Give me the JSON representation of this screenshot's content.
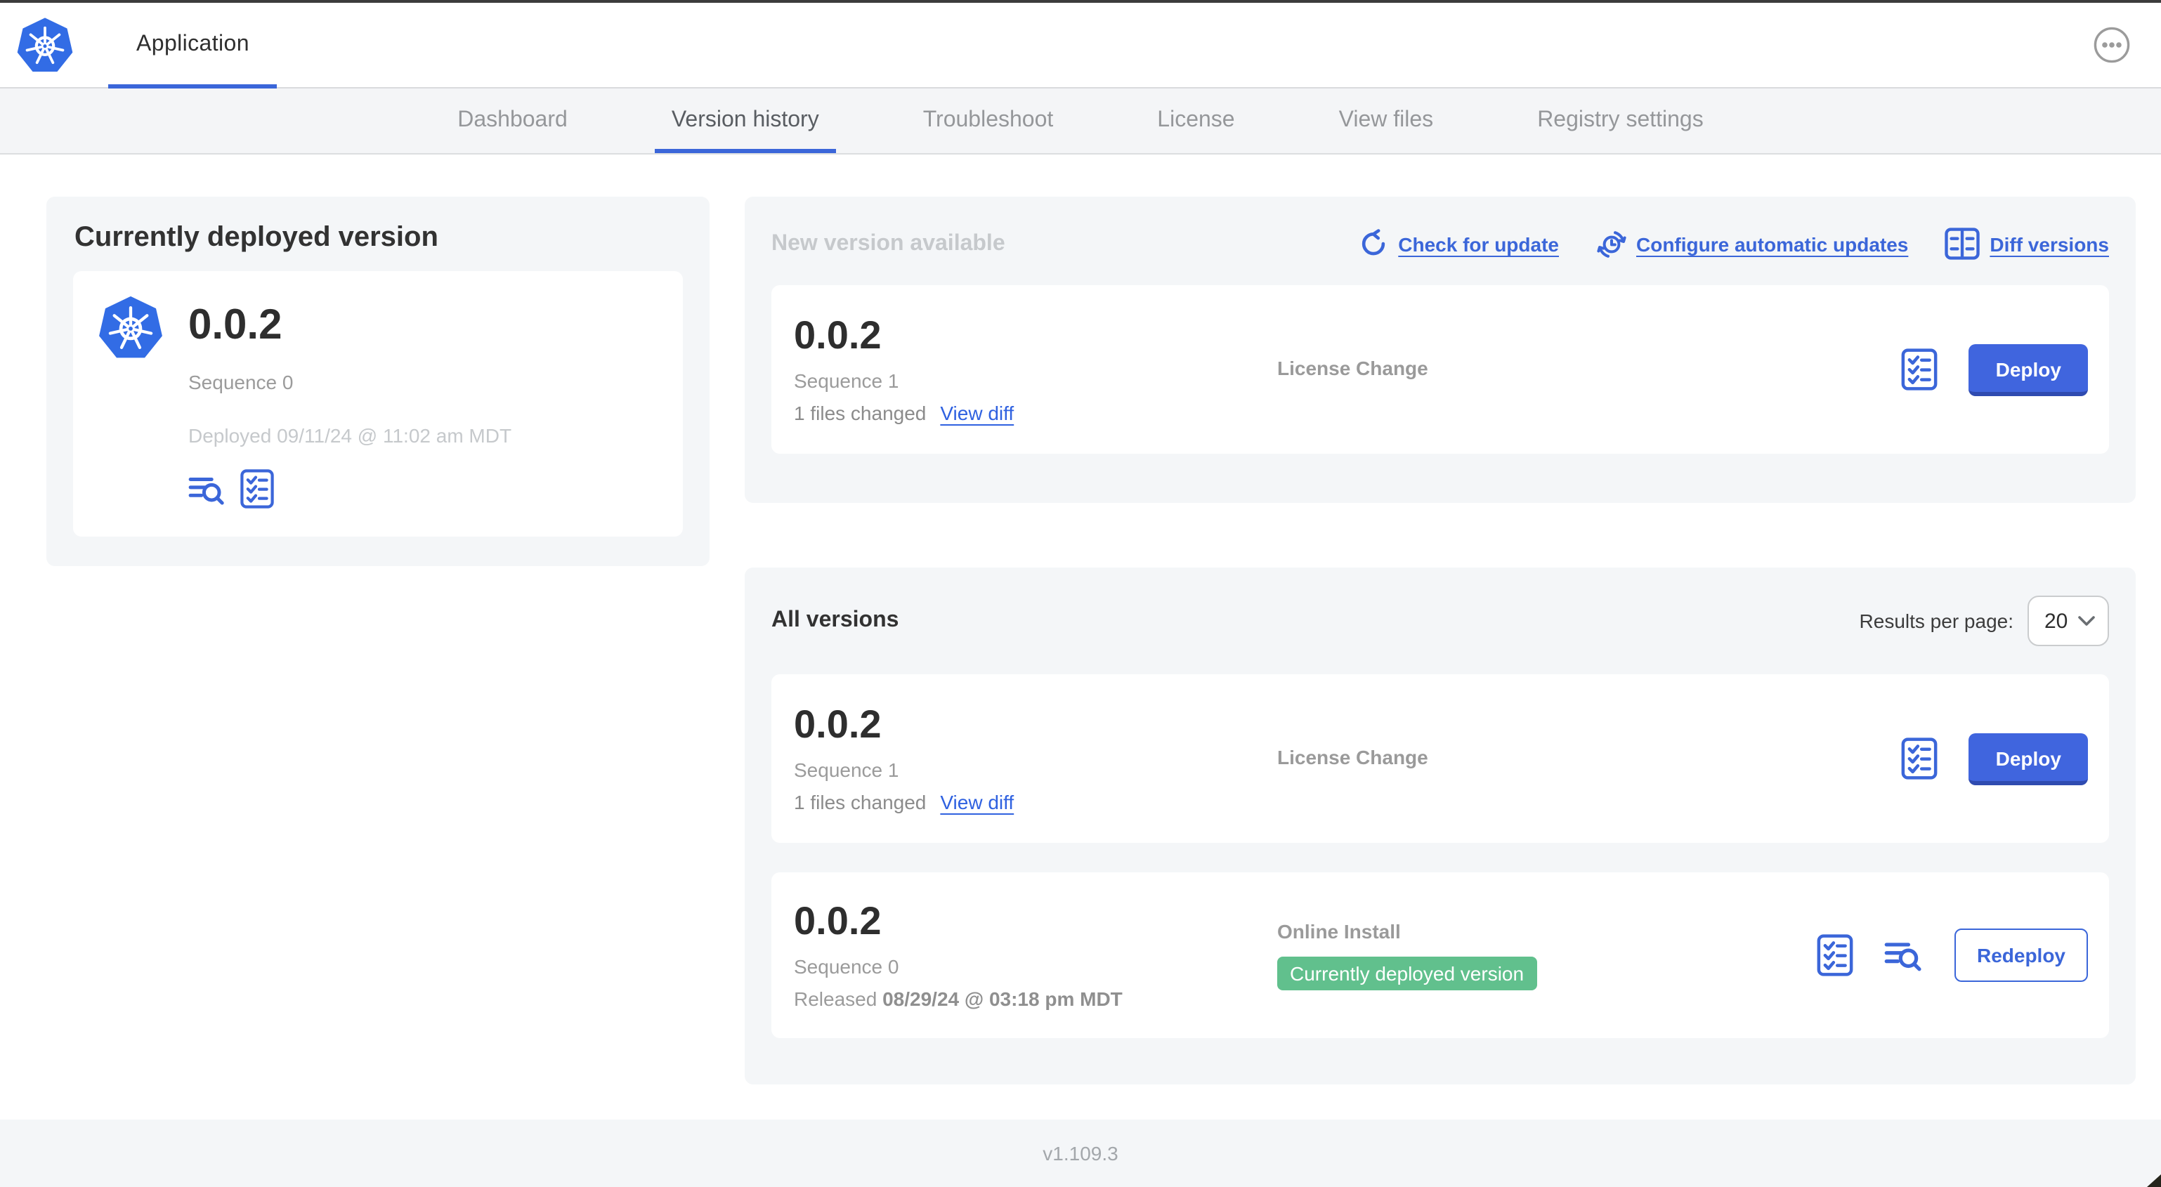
{
  "colors": {
    "accent_blue": "#3B66D9",
    "button_blue": "#4065DE",
    "badge_green": "#61C08D",
    "k8s_logo_blue": "#326CE5",
    "panel_gray": "#f4f6f8"
  },
  "header": {
    "app_tab": "Application"
  },
  "nav": {
    "tabs": [
      {
        "label": "Dashboard",
        "active": false
      },
      {
        "label": "Version history",
        "active": true
      },
      {
        "label": "Troubleshoot",
        "active": false
      },
      {
        "label": "License",
        "active": false
      },
      {
        "label": "View files",
        "active": false
      },
      {
        "label": "Registry settings",
        "active": false
      }
    ]
  },
  "current_deployed": {
    "title": "Currently deployed version",
    "version": "0.0.2",
    "sequence": "Sequence 0",
    "deployed_at": "Deployed 09/11/24 @ 11:02 am MDT"
  },
  "new_version": {
    "title": "New version available",
    "actions": {
      "check_for_update": "Check for update",
      "configure_automatic_updates": "Configure automatic updates",
      "diff_versions": "Diff versions"
    },
    "row": {
      "version": "0.0.2",
      "sequence": "Sequence 1",
      "files_changed": "1 files changed",
      "view_diff": "View diff",
      "source": "License Change",
      "action": "Deploy"
    }
  },
  "all_versions": {
    "title": "All versions",
    "results_per_page_label": "Results per page:",
    "results_per_page_value": "20",
    "rows": [
      {
        "version": "0.0.2",
        "sequence": "Sequence 1",
        "files_changed": "1 files changed",
        "view_diff": "View diff",
        "source": "License Change",
        "action": "Deploy"
      },
      {
        "version": "0.0.2",
        "sequence": "Sequence 0",
        "released_prefix": "Released",
        "released_date": "08/29/24 @ 03:18 pm MDT",
        "source": "Online Install",
        "badge": "Currently deployed version",
        "action": "Redeploy"
      }
    ]
  },
  "footer": {
    "version": "v1.109.3"
  }
}
